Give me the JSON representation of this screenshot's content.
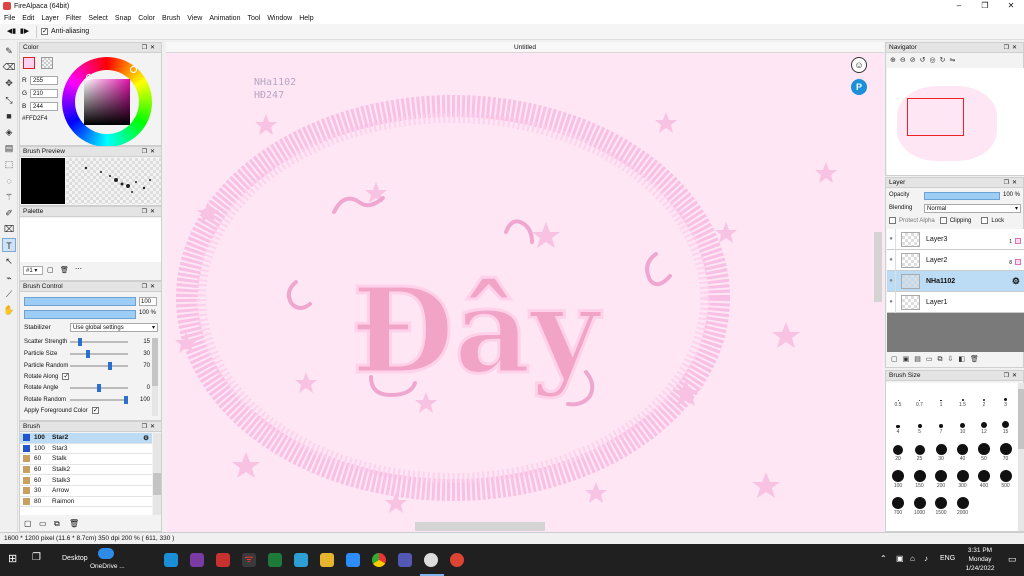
{
  "window": {
    "title": "FireAlpaca (64bit)"
  },
  "menu": [
    "File",
    "Edit",
    "Layer",
    "Filter",
    "Select",
    "Snap",
    "Color",
    "Brush",
    "View",
    "Animation",
    "Tool",
    "Window",
    "Help"
  ],
  "toolbar": {
    "antialias_label": "Anti-aliasing",
    "antialias_on": true
  },
  "color_panel": {
    "title": "Color",
    "r_label": "R",
    "r": "255",
    "g_label": "G",
    "g": "210",
    "b_label": "B",
    "b": "244",
    "hex": "#FFD2F4",
    "current_color": "#ffd2f4"
  },
  "brush_preview": {
    "title": "Brush Preview"
  },
  "palette": {
    "title": "Palette",
    "selector": "#1"
  },
  "brush_control": {
    "title": "Brush Control",
    "size": "100",
    "opacity": "100 %",
    "stabilizer_label": "Stabilizer",
    "stabilizer_value": "Use global settings",
    "params": [
      {
        "label": "Scatter Strength",
        "value": "15",
        "fraction": 0.15
      },
      {
        "label": "Particle Size",
        "value": "30",
        "fraction": 0.3
      },
      {
        "label": "Particle Random",
        "value": "70",
        "fraction": 0.7
      }
    ],
    "rotate_along_label": "Rotate Along",
    "rotate_angle": {
      "label": "Rotate Angle",
      "value": "0",
      "fraction": 0.5
    },
    "rotate_random": {
      "label": "Rotate Random",
      "value": "100",
      "fraction": 1.0
    },
    "apply_fg_label": "Apply Foreground Color"
  },
  "brush_list": {
    "title": "Brush",
    "items": [
      {
        "size": "100",
        "name": "Star2",
        "color": "#2255cc",
        "selected": true
      },
      {
        "size": "100",
        "name": "Star3",
        "color": "#2255cc"
      },
      {
        "size": "60",
        "name": "Stalk",
        "color": "#c8a060"
      },
      {
        "size": "60",
        "name": "Stalk2",
        "color": "#c8a060"
      },
      {
        "size": "60",
        "name": "Stalk3",
        "color": "#c8a060"
      },
      {
        "size": "30",
        "name": "Arrow",
        "color": "#c8a060"
      },
      {
        "size": "80",
        "name": "Raimon",
        "color": "#c8a060"
      }
    ]
  },
  "document": {
    "tab_title": "Untitled",
    "watermark_line1": "NHa1102",
    "watermark_line2": "HĐ247",
    "artwork_text": "Đây"
  },
  "navigator": {
    "title": "Navigator"
  },
  "layer_panel": {
    "title": "Layer",
    "opacity_label": "Opacity",
    "opacity_value": "100 %",
    "blending_label": "Blending",
    "blending_value": "Normal",
    "protect_alpha_label": "Protect Alpha",
    "clipping_label": "Clipping",
    "lock_label": "Lock",
    "layers": [
      {
        "name": "Layer3",
        "badge": "1"
      },
      {
        "name": "Layer2",
        "badge": "8"
      },
      {
        "name": "NHa1102",
        "selected": true
      },
      {
        "name": "Layer1"
      }
    ]
  },
  "brush_size": {
    "title": "Brush Size",
    "sizes": [
      "0.5",
      "0.7",
      "1",
      "1.5",
      "2",
      "3",
      "4",
      "5",
      "7",
      "10",
      "12",
      "15",
      "20",
      "25",
      "30",
      "40",
      "50",
      "70",
      "100",
      "150",
      "200",
      "300",
      "400",
      "500",
      "700",
      "1000",
      "1500",
      "2000"
    ]
  },
  "status": {
    "text": "1600 * 1200 pixel  (11.6 * 8.7cm)  350 dpi  200 %  ( 611, 330 )"
  },
  "taskbar": {
    "desktop_label": "Desktop",
    "onedrive_label": "OneDrive ...",
    "lang": "ENG",
    "time": "3:31 PM",
    "day": "Monday",
    "date": "1/24/2022"
  }
}
